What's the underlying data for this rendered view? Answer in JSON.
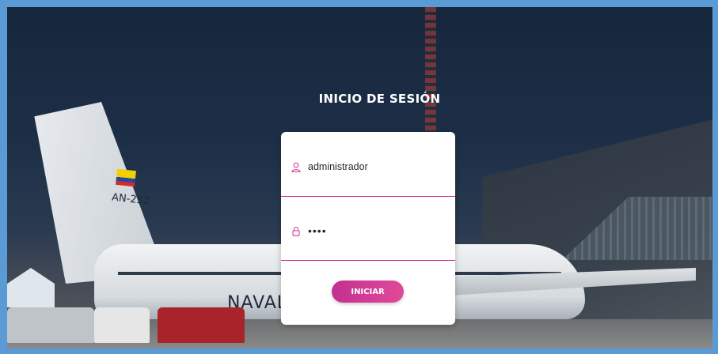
{
  "login": {
    "title": "INICIO DE SESIÓN",
    "username_value": "administrador",
    "password_value": "••••",
    "submit_label": "INICIAR"
  },
  "background": {
    "tail_marking": "AN-232",
    "fuselage_marking": "NAVAL"
  },
  "icons": {
    "username": "user-icon",
    "password": "lock-icon"
  },
  "colors": {
    "accent": "#c51f8a",
    "button_gradient_start": "#c2308f",
    "button_gradient_end": "#e2499a",
    "frame": "#5b9bd5"
  }
}
